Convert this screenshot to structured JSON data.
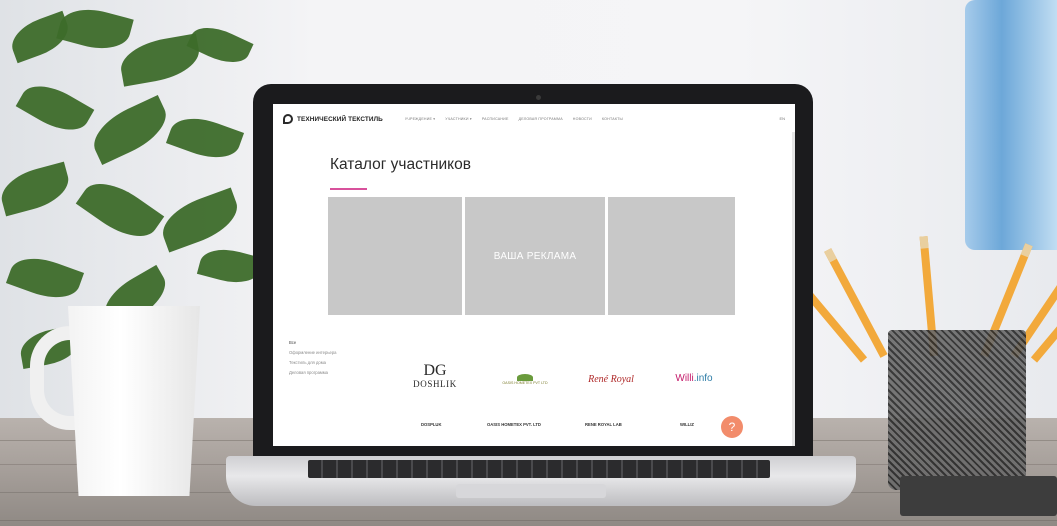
{
  "site": {
    "logo_text": "ТЕХНИЧЕСКИЙ ТЕКСТИЛЬ",
    "nav": [
      "УЧРЕЖДЕНИЕ ▾",
      "УЧАСТНИКИ ▾",
      "РАСПИСАНИЕ",
      "ДЕЛОВАЯ ПРОГРАММА",
      "НОВОСТИ",
      "КОНТАКТЫ"
    ],
    "lang": "EN"
  },
  "page": {
    "title": "Каталог участников",
    "banner_label": "ВАША РЕКЛАМА",
    "accent_color": "#d8519c"
  },
  "categories": [
    "Все",
    "Оформление интерьера",
    "Текстиль для дома",
    "Деловая программа"
  ],
  "brands": {
    "dg_mark": "DG",
    "dg_text": "DOSHLIK",
    "oasis_text": "OASIS HOMETEX PVT LTD",
    "rene_text": "René Royal",
    "willz_text": ".info",
    "willz_prefix": "Willi"
  },
  "participants": [
    "DOSPLUK",
    "OASIS HOMETEX PVT. LTD",
    "RENE ROYAL LAB",
    "WILLIZ"
  ],
  "help_label": "?"
}
